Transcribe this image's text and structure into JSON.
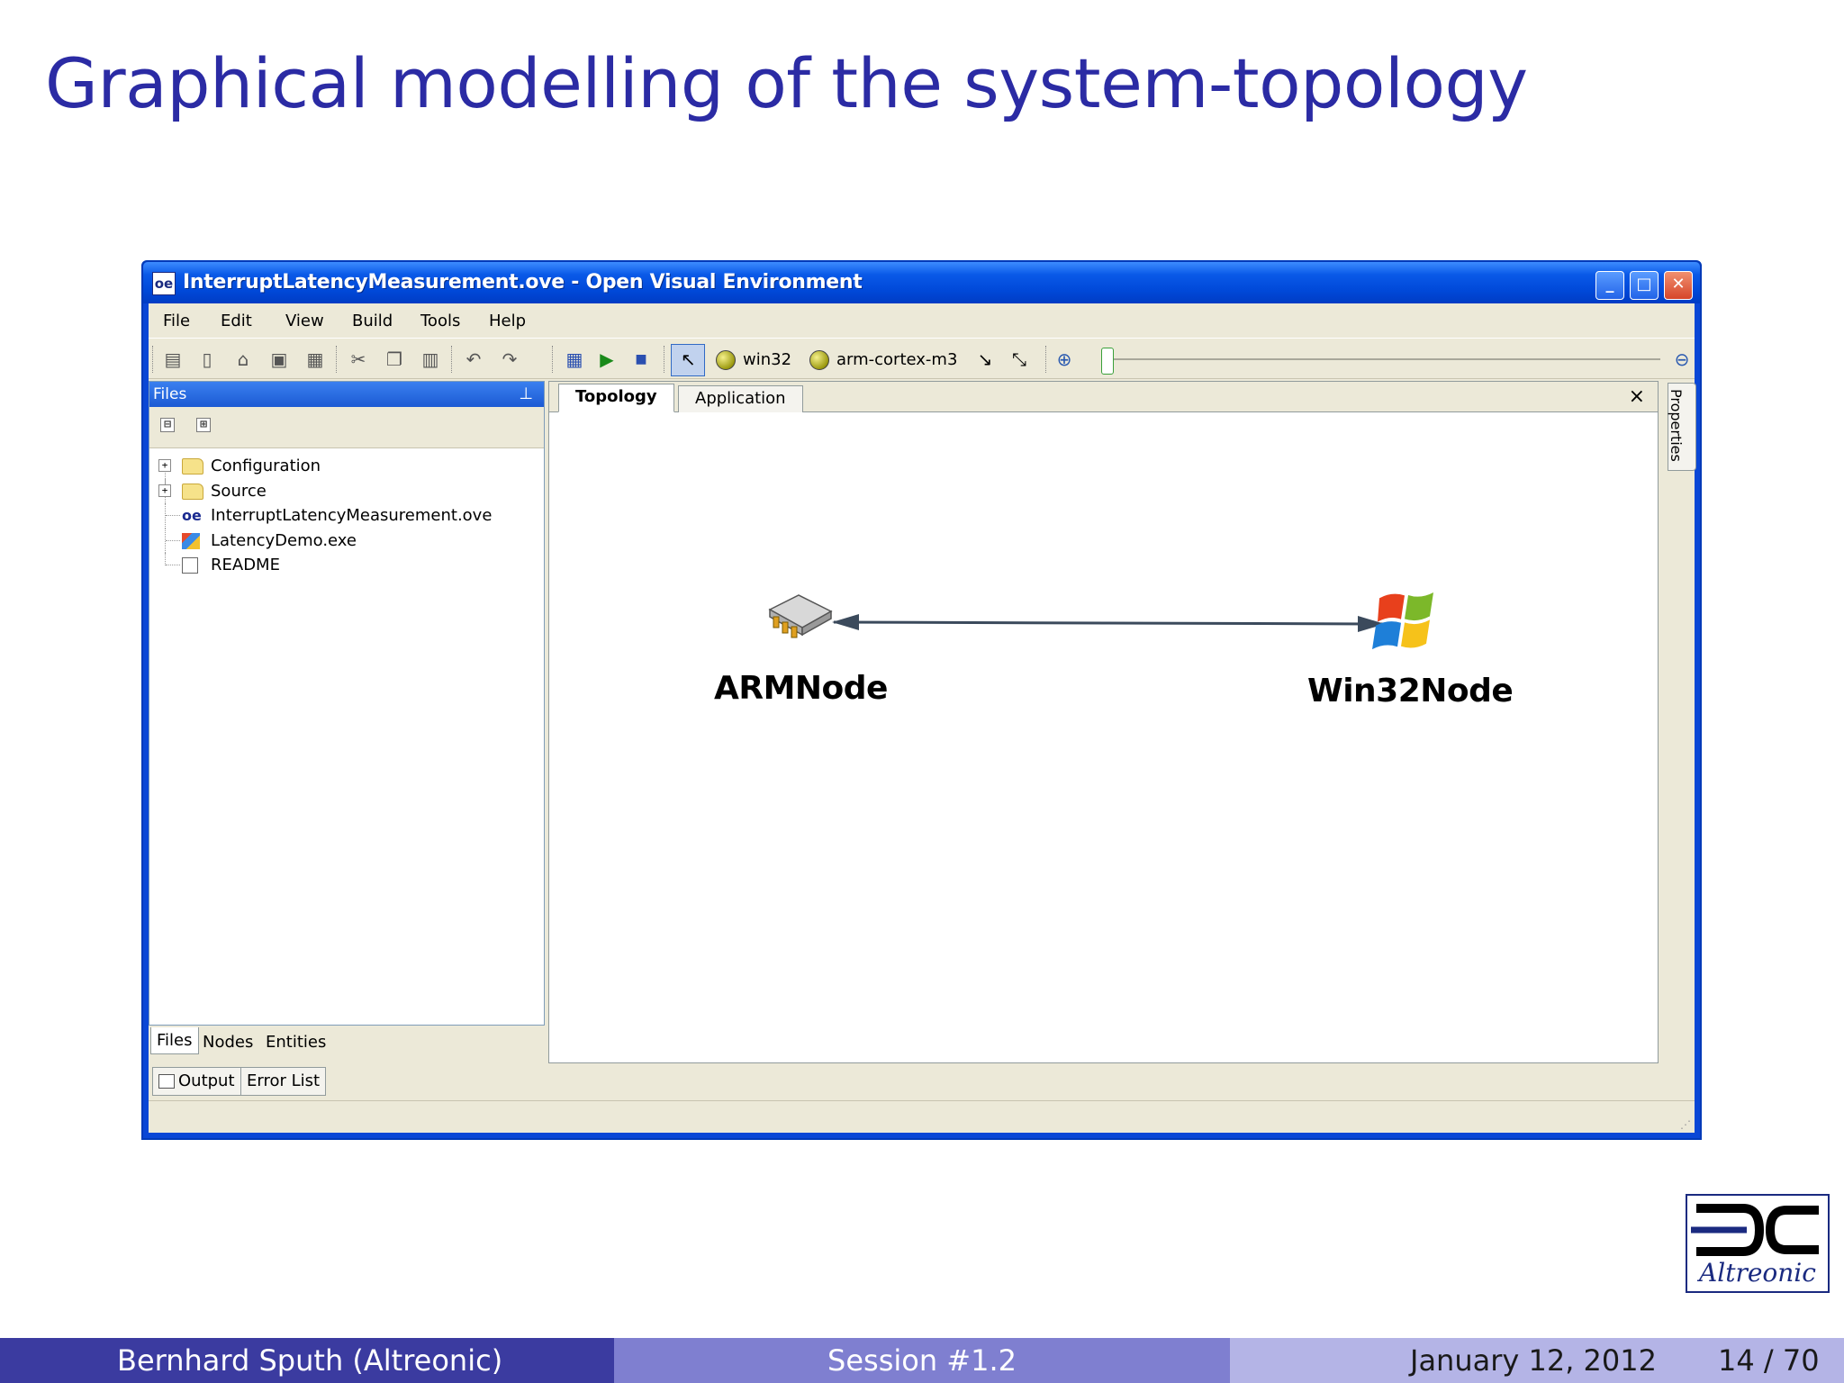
{
  "slide": {
    "title": "Graphical modelling of the system-topology"
  },
  "window": {
    "icon_text": "oe",
    "title": "InterruptLatencyMeasurement.ove - Open Visual Environment",
    "titlebar_color": "#0a5ae8"
  },
  "menu": {
    "file": "File",
    "edit": "Edit",
    "view": "View",
    "build": "Build",
    "tools": "Tools",
    "help": "Help"
  },
  "toolbar": {
    "target_a": "win32",
    "target_b": "arm-cortex-m3"
  },
  "files_panel": {
    "header": "Files",
    "collapse_label": "⊟",
    "expand_label": "⊞",
    "items": [
      {
        "label": "Configuration"
      },
      {
        "label": "Source"
      },
      {
        "label": "InterruptLatencyMeasurement.ove"
      },
      {
        "label": "LatencyDemo.exe"
      },
      {
        "label": "README"
      }
    ],
    "tabs": [
      "Files",
      "Nodes",
      "Entities"
    ]
  },
  "bottom_tabs": {
    "output": "Output",
    "error_list": "Error List"
  },
  "editor": {
    "tabs": [
      "Topology",
      "Application"
    ],
    "close": "×",
    "nodes": [
      {
        "label": "ARMNode"
      },
      {
        "label": "Win32Node"
      }
    ]
  },
  "properties_tab": "Properties",
  "logo": {
    "text": "Altreonic"
  },
  "footer": {
    "author": "Bernhard Sputh  (Altreonic)",
    "session": "Session #1.2",
    "date": "January 12, 2012",
    "page": "14 / 70",
    "colors": [
      "#3b3ba0",
      "#7f7fd0",
      "#b4b4e6"
    ]
  }
}
